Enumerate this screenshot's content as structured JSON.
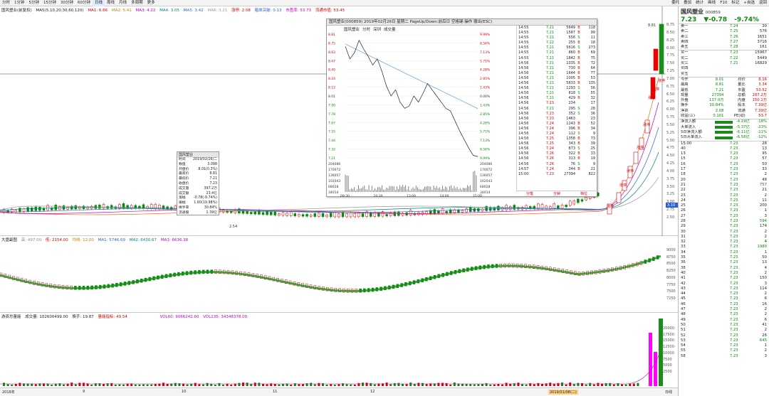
{
  "toolbar": {
    "left": [
      "分时",
      "1分钟",
      "5分钟",
      "15分钟",
      "30分钟",
      "60分钟",
      "日线",
      "周线",
      "月线",
      "多周期",
      "更多"
    ],
    "right": [
      "委托",
      "叠加",
      "统计",
      "画线",
      "F10",
      "标记",
      "+自选",
      "返回"
    ],
    "active_index": 6
  },
  "main_legend": {
    "name": "国风塑业(前复权)",
    "ma": "MA5(5,10,20,30,60,120)",
    "ma1": "MA1: 6.66",
    "ma2": "MA2: 5.41",
    "ma3": "MA3: 4.22",
    "ma4": "MA4: 3.05",
    "ma5": "MA5: 3.42",
    "ma6": "MA6: 3.21",
    "extra1": "涨停: 2.08",
    "extra2": "箱体突破: 0.13",
    "extra3": "市盈率: 53.73",
    "extra4": "流通市值: 53.45"
  },
  "main_yaxis": [
    "8.75",
    "8.50",
    "8.25",
    "8.00",
    "7.75",
    "7.50",
    "7.25",
    "7.00",
    "6.75",
    "6.50",
    "6.25",
    "6.00",
    "5.75",
    "5.50",
    "5.25",
    "5.00",
    "4.75",
    "4.50",
    "4.25",
    "4.00",
    "3.75",
    "3.50",
    "3.25",
    "3.00",
    "2.75",
    "2.50"
  ],
  "main_annotations": {
    "high": "8.81",
    "low": "2.54",
    "current_tag": "3.10",
    "limit_labels": [
      "涨停",
      "涨停",
      "涨停",
      "涨停",
      "涨停",
      "涨停",
      "涨停",
      "涨停"
    ]
  },
  "mid_legend": {
    "name": "大盘副图",
    "a": "高: 497.00",
    "b": "低: 2154.00",
    "c": "均线: 12.00",
    "d": "MA1: 5746.69",
    "e": "MA2: 6430.67",
    "f": "MA3: 6636.38"
  },
  "mid_yaxis": [
    "9000",
    "8750",
    "8500",
    "8250",
    "8000",
    "7750",
    "7500",
    "7250"
  ],
  "vol_legend": {
    "name": "游资总量能",
    "a": "成交量: 102600499.00",
    "b": "换手: 19.87",
    "c": "量能指标: 49.54",
    "d": "VOL60: 9066242.60",
    "e": "VOL135: 34348378.00"
  },
  "vol_yaxis": [
    "20000",
    "17500",
    "15000",
    "12500",
    "10000",
    "7500",
    "5000",
    "2500"
  ],
  "datebar": {
    "left": "2018年",
    "m1": "9",
    "m2": "10",
    "m3": "11",
    "m4": "12",
    "current": "2019/01/08(二)",
    "right": "日线"
  },
  "quote": {
    "name": "国风塑业",
    "code": "000859",
    "price": "7.23",
    "change": "▼-0.78",
    "pct": "-9.74%",
    "sell": [
      {
        "label": "卖五",
        "price": "7.28",
        "vol": "161"
      },
      {
        "label": "卖四",
        "price": "7.27",
        "vol": "3716"
      },
      {
        "label": "卖三",
        "price": "7.26",
        "vol": "1651"
      },
      {
        "label": "卖二",
        "price": "7.25",
        "vol": "576"
      },
      {
        "label": "卖一",
        "price": "7.24",
        "vol": "30"
      }
    ],
    "buy": [
      {
        "label": "买一",
        "price": "7.23",
        "vol": "15967"
      },
      {
        "label": "买二",
        "price": "7.22",
        "vol": "5449"
      },
      {
        "label": "买三",
        "price": "7.21",
        "vol": "16829"
      },
      {
        "label": "买四",
        "price": "",
        "vol": ""
      },
      {
        "label": "买五",
        "price": "",
        "vol": ""
      }
    ],
    "stats": [
      {
        "a": "今开",
        "b": "8.01",
        "c": "均价",
        "d": "8.16"
      },
      {
        "a": "最高",
        "b": "8.81",
        "c": "量比",
        "d": "3.34"
      },
      {
        "a": "最低",
        "b": "7.21",
        "c": "市盈",
        "d": "53.52"
      },
      {
        "a": "现量",
        "b": "27394",
        "c": "总额",
        "d": "287.2万"
      },
      {
        "a": "外盘",
        "b": "137.0万",
        "c": "内盘",
        "d": "150.1万"
      },
      {
        "a": "换手",
        "b": "30.84%",
        "c": "股本",
        "d": "7.39亿"
      },
      {
        "a": "净资",
        "b": "2.08",
        "c": "流通",
        "d": "7.39亿"
      },
      {
        "a": "收益(三)",
        "b": "0.101",
        "c": "PE(动)",
        "d": "53.7"
      }
    ],
    "flows": [
      {
        "label": "净流入额",
        "val": "-4.19亿",
        "pct": "-18%"
      },
      {
        "label": "大单流入",
        "val": "-5.37亿",
        "pct": "-23%"
      },
      {
        "label": "5日净流入额",
        "val": "-6.11亿",
        "pct": "-11%"
      },
      {
        "label": "5日大单流入",
        "val": "-6.58亿",
        "pct": "-12%"
      }
    ],
    "ticks": [
      {
        "t": "15:00",
        "p": "7.23",
        "v": "28"
      },
      {
        "t": "40",
        "p": "7.23",
        "v": "13"
      },
      {
        "t": "13",
        "p": "7.23",
        "v": "95"
      },
      {
        "t": "15",
        "p": "7.23",
        "v": "57"
      },
      {
        "t": "16",
        "p": "7.23",
        "v": "50"
      },
      {
        "t": "17",
        "p": "7.23",
        "v": "33"
      },
      {
        "t": "18",
        "p": "7.23",
        "v": "2"
      },
      {
        "t": "20",
        "p": "7.23",
        "v": "48"
      },
      {
        "t": "21",
        "p": "7.23",
        "v": "757"
      },
      {
        "t": "22",
        "p": "7.23",
        "v": "21"
      },
      {
        "t": "23",
        "p": "7.23",
        "v": "2"
      },
      {
        "t": "24",
        "p": "7.23",
        "v": "11"
      },
      {
        "t": "25",
        "p": "7.23",
        "v": "200"
      },
      {
        "t": "26",
        "p": "7.23",
        "v": "1"
      },
      {
        "t": "27",
        "p": "7.23",
        "v": "3"
      },
      {
        "t": "28",
        "p": "7.23",
        "v": "594"
      },
      {
        "t": "29",
        "p": "7.23",
        "v": "174"
      },
      {
        "t": "30",
        "p": "7.23",
        "v": "2"
      },
      {
        "t": "31",
        "p": "7.23",
        "v": "2"
      },
      {
        "t": "32",
        "p": "7.23",
        "v": "4"
      },
      {
        "t": "33",
        "p": "7.23",
        "v": "1980"
      },
      {
        "t": "34",
        "p": "7.23",
        "v": "1"
      },
      {
        "t": "35",
        "p": "7.23",
        "v": "50"
      },
      {
        "t": "36",
        "p": "7.23",
        "v": "13"
      },
      {
        "t": "38",
        "p": "7.23",
        "v": "4"
      },
      {
        "t": "40",
        "p": "7.23",
        "v": "2"
      },
      {
        "t": "41",
        "p": "7.23",
        "v": "150"
      },
      {
        "t": "42",
        "p": "7.23",
        "v": "3"
      },
      {
        "t": "43",
        "p": "7.23",
        "v": "114"
      },
      {
        "t": "44",
        "p": "7.23",
        "v": "2"
      },
      {
        "t": "45",
        "p": "7.23",
        "v": "6"
      },
      {
        "t": "46",
        "p": "7.23",
        "v": "16"
      },
      {
        "t": "47",
        "p": "7.23",
        "v": "2"
      },
      {
        "t": "48",
        "p": "7.23",
        "v": "2"
      },
      {
        "t": "49",
        "p": "7.23",
        "v": "6"
      },
      {
        "t": "50",
        "p": "7.23",
        "v": "41"
      },
      {
        "t": "51",
        "p": "7.23",
        "v": "2"
      },
      {
        "t": "52",
        "p": "7.23",
        "v": "26"
      },
      {
        "t": "53",
        "p": "7.23",
        "v": "645"
      },
      {
        "t": "54",
        "p": "7.23",
        "v": "1"
      },
      {
        "t": "55",
        "p": "7.23",
        "v": "2"
      },
      {
        "t": "58",
        "p": "7.23",
        "v": "3"
      }
    ]
  },
  "minute_popup": {
    "title": "国风塑业(000859)  2019年02月26日 星期二  PageUp/Down:前后日  空格键:操作  撤出(ESC)",
    "tab1": "国风塑业",
    "tab2": "分时",
    "tab3": "深圳",
    "tab4": "成交量",
    "left_axis": [
      "8.81",
      "8.75",
      "8.63",
      "8.47",
      "8.40",
      "8.24",
      "8.12",
      "8.01",
      "7.90",
      "7.78",
      "7.67",
      "7.55",
      "7.44",
      "7.32",
      "7.21"
    ],
    "right_axis": [
      "9.99%",
      "8.56%",
      "7.13%",
      "5.71%",
      "4.28%",
      "2.85%",
      "1.43%",
      "0.00%",
      "1.43%",
      "2.85%",
      "4.28%",
      "5.71%",
      "7.13%",
      "8.56%",
      "9.99%"
    ],
    "vol_axis": [
      "204086",
      "170072",
      "136057",
      "102043",
      "68028",
      "34014"
    ],
    "time_axis": [
      "09:30",
      "10:30",
      "13:00",
      "14:00",
      "15:00"
    ],
    "ticks": [
      {
        "t": "14:55",
        "p": "7.21",
        "v": "5649",
        "s": "B",
        "n": "118"
      },
      {
        "t": "14:55",
        "p": "7.21",
        "v": "1587",
        "s": "B",
        "n": "99"
      },
      {
        "t": "14:55",
        "p": "7.21",
        "v": "556",
        "s": "S",
        "n": "11"
      },
      {
        "t": "14:55",
        "p": "7.22",
        "v": "255",
        "s": "B",
        "n": "18"
      },
      {
        "t": "14:55",
        "p": "7.21",
        "v": "5616",
        "s": "S",
        "n": "273"
      },
      {
        "t": "14:55",
        "p": "7.21",
        "v": "860",
        "s": "B",
        "n": "69"
      },
      {
        "t": "14:55",
        "p": "7.21",
        "v": "1842",
        "s": "B",
        "n": "75"
      },
      {
        "t": "14:56",
        "p": "7.21",
        "v": "1035",
        "s": "B",
        "n": "72"
      },
      {
        "t": "14:56",
        "p": "7.21",
        "v": "730",
        "s": "B",
        "n": "64"
      },
      {
        "t": "14:56",
        "p": "7.21",
        "v": "1644",
        "s": "B",
        "n": "77"
      },
      {
        "t": "14:56",
        "p": "7.21",
        "v": "1005",
        "s": "B",
        "n": "53"
      },
      {
        "t": "14:56",
        "p": "7.21",
        "v": "5633",
        "s": "B",
        "n": "135"
      },
      {
        "t": "14:56",
        "p": "7.21",
        "v": "1293",
        "s": "S",
        "n": "56"
      },
      {
        "t": "14:56",
        "p": "7.21",
        "v": "818",
        "s": "S",
        "n": "55"
      },
      {
        "t": "14:56",
        "p": "7.21",
        "v": "429",
        "s": "B",
        "n": "32"
      },
      {
        "t": "14:56",
        "p": "7.23",
        "v": "234",
        "s": "",
        "n": "17"
      },
      {
        "t": "14:56",
        "p": "7.21",
        "v": "295",
        "s": "S",
        "n": "28"
      },
      {
        "t": "14:56",
        "p": "7.23",
        "v": "352",
        "s": "S",
        "n": "36"
      },
      {
        "t": "14:56",
        "p": "7.23",
        "v": "1463",
        "s": "",
        "n": "23"
      },
      {
        "t": "14:56",
        "p": "7.24",
        "v": "1243",
        "s": "B",
        "n": "52"
      },
      {
        "t": "14:56",
        "p": "7.24",
        "v": "396",
        "s": "B",
        "n": "34"
      },
      {
        "t": "14:56",
        "p": "7.24",
        "v": "112",
        "s": "S",
        "n": "9"
      },
      {
        "t": "14:56",
        "p": "7.25",
        "v": "1358",
        "s": "B",
        "n": "73"
      },
      {
        "t": "14:56",
        "p": "7.25",
        "v": "343",
        "s": "B",
        "n": "39"
      },
      {
        "t": "14:56",
        "p": "7.24",
        "v": "873",
        "s": "S",
        "n": "25"
      },
      {
        "t": "14:56",
        "p": "7.26",
        "v": "322",
        "s": "B",
        "n": "33"
      },
      {
        "t": "14:56",
        "p": "7.26",
        "v": "313",
        "s": "B",
        "n": "19"
      },
      {
        "t": "14:56",
        "p": "7.26",
        "v": "76",
        "s": "S",
        "n": "9"
      },
      {
        "t": "14:57",
        "p": "7.24",
        "v": "344",
        "s": "B",
        "n": "21"
      },
      {
        "t": "15:00",
        "p": "7.23",
        "v": "27394",
        "s": "",
        "n": "822"
      }
    ],
    "foot": [
      "分笔",
      "分钟",
      "档位"
    ]
  },
  "info_popup": {
    "title": "国风塑业",
    "rows": [
      {
        "k": "时间",
        "v": "2019/02/26/二"
      },
      {
        "k": "数值",
        "v": "3.098"
      },
      {
        "k": "开盘价",
        "v": "8.01(0.3%)"
      },
      {
        "k": "最高价",
        "v": "8.81"
      },
      {
        "k": "最低价",
        "v": "7.21"
      },
      {
        "k": "收盘价",
        "v": "7.23"
      },
      {
        "k": "成交量",
        "v": "397.2万"
      },
      {
        "k": "成交额",
        "v": "23.4亿"
      },
      {
        "k": "涨幅",
        "v": "-0.78(-9.74%)"
      },
      {
        "k": "振幅",
        "v": "1.60(19.98%)"
      },
      {
        "k": "换手率",
        "v": "30.84%"
      },
      {
        "k": "流通股",
        "v": "1.39亿"
      }
    ]
  },
  "colors": {
    "up": "#d40000",
    "down": "#0a8a0a",
    "magenta": "#ff00ff",
    "accent": "#2b5fd9"
  }
}
